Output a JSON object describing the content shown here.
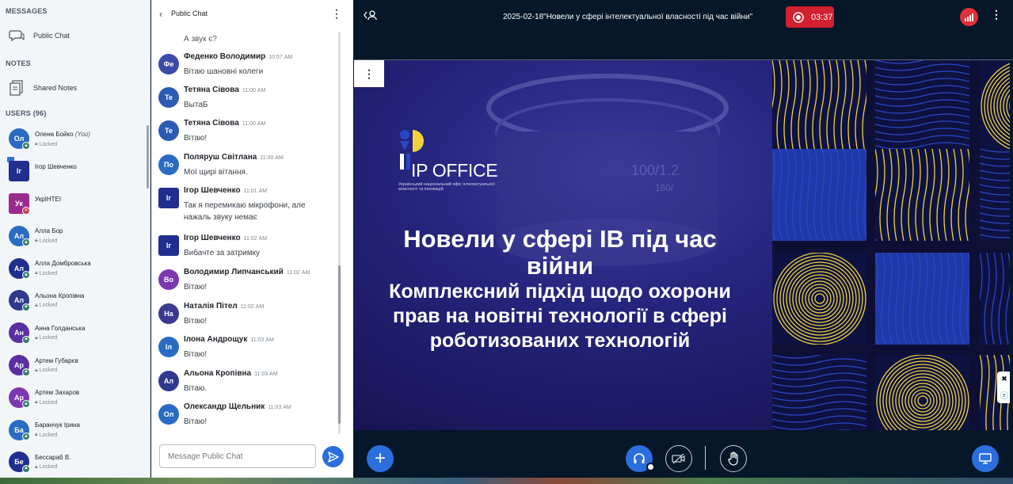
{
  "sidebar": {
    "messages_title": "MESSAGES",
    "public_chat_label": "Public Chat",
    "notes_title": "NOTES",
    "shared_notes_label": "Shared Notes",
    "users_title": "USERS (96)",
    "locked_label": "Locked",
    "users": [
      {
        "initials": "Ол",
        "name": "Олена Бойко",
        "you": "(You)",
        "color": "#2a6cc4",
        "shape": "circle",
        "status": "locked",
        "presenter": false
      },
      {
        "initials": "Іг",
        "name": "Ігор Шевченко",
        "you": "",
        "color": "#1f2e8f",
        "shape": "square",
        "status": "none",
        "presenter": true
      },
      {
        "initials": "Ук",
        "name": "УкрІНТЕІ",
        "you": "",
        "color": "#9b2a8f",
        "shape": "square",
        "status": "muted",
        "presenter": false
      },
      {
        "initials": "Ал",
        "name": "Алла Бор",
        "you": "",
        "color": "#2a6cc4",
        "shape": "circle",
        "status": "locked",
        "presenter": false
      },
      {
        "initials": "Ал",
        "name": "Алла Домбровська",
        "you": "",
        "color": "#1f2e8f",
        "shape": "circle",
        "status": "locked",
        "presenter": false
      },
      {
        "initials": "Ал",
        "name": "Альона Кропівна",
        "you": "",
        "color": "#2f3a8f",
        "shape": "circle",
        "status": "locked",
        "presenter": false
      },
      {
        "initials": "Ан",
        "name": "Анна Голданська",
        "you": "",
        "color": "#5a2fa3",
        "shape": "circle",
        "status": "locked",
        "presenter": false
      },
      {
        "initials": "Ар",
        "name": "Артем Губарєв",
        "you": "",
        "color": "#5a2fa3",
        "shape": "circle",
        "status": "locked",
        "presenter": false
      },
      {
        "initials": "Ар",
        "name": "Артем Захаров",
        "you": "",
        "color": "#7c38b0",
        "shape": "circle",
        "status": "locked",
        "presenter": false
      },
      {
        "initials": "Ба",
        "name": "Баранчук Ірина",
        "you": "",
        "color": "#2a6cc4",
        "shape": "circle",
        "status": "locked",
        "presenter": false
      },
      {
        "initials": "Бе",
        "name": "Бессараб В.",
        "you": "",
        "color": "#1f2e8f",
        "shape": "circle",
        "status": "locked",
        "presenter": false
      }
    ]
  },
  "chat": {
    "title": "Public Chat",
    "faded_message": "А звук є?",
    "messages": [
      {
        "initials": "Фе",
        "name": "Феденко Володимир",
        "time": "10:57 AM",
        "text": "Вітаю шановні колеги",
        "color": "#3a4aa8",
        "shape": "circle"
      },
      {
        "initials": "Те",
        "name": "Тетяна Сівова",
        "time": "11:00 AM",
        "text": "ВытаБ",
        "color": "#2a5cb4",
        "shape": "circle"
      },
      {
        "initials": "Те",
        "name": "Тетяна Сівова",
        "time": "11:00 AM",
        "text": "Вітаю!",
        "color": "#2a5cb4",
        "shape": "circle"
      },
      {
        "initials": "По",
        "name": "Поляруш Світлана",
        "time": "11:00 AM",
        "text": "Мої щирі вітання.",
        "color": "#2a6cc4",
        "shape": "circle"
      },
      {
        "initials": "Іг",
        "name": "Ігор Шевченко",
        "time": "11:01 AM",
        "text": "Так я перемикаю мікрофони, але нажаль звуку немає",
        "color": "#1f2e8f",
        "shape": "square"
      },
      {
        "initials": "Іг",
        "name": "Ігор Шевченко",
        "time": "11:02 AM",
        "text": "Вибачте за затримку",
        "color": "#1f2e8f",
        "shape": "square"
      },
      {
        "initials": "Во",
        "name": "Володимир Липчанський",
        "time": "11:02 AM",
        "text": "Вітаю!",
        "color": "#7c38b0",
        "shape": "circle"
      },
      {
        "initials": "На",
        "name": "Наталія Пітел",
        "time": "11:02 AM",
        "text": "Вітаю!",
        "color": "#3a3a8f",
        "shape": "circle"
      },
      {
        "initials": "Іл",
        "name": "Ілона Андрощук",
        "time": "11:03 AM",
        "text": "Вітаю!",
        "color": "#2a6cc4",
        "shape": "circle"
      },
      {
        "initials": "Ал",
        "name": "Альона Кропівна",
        "time": "11:03 AM",
        "text": "Вітаю.",
        "color": "#2f3a8f",
        "shape": "circle"
      },
      {
        "initials": "Ол",
        "name": "Олександр Щельник",
        "time": "11:03 AM",
        "text": "Вітаю!",
        "color": "#2a6cc4",
        "shape": "circle"
      }
    ],
    "input_placeholder": "Message Public Chat"
  },
  "main": {
    "meeting_title": "2025-02-18\"Новели у сфері інтелектуальної власності під час війни\"",
    "recording_time": "03:37",
    "slide": {
      "logo_text": "IP OFFICE",
      "logo_subtitle": "Український національний офіс інтелектуальної власності та інновацій",
      "title": "Новели у сфері ІВ під час війни",
      "subtitle": "Комплексний підхід щодо охорони прав на новітні технології в сфері роботизованих технологій"
    }
  },
  "colors": {
    "accent": "#2b6fde",
    "recording": "#d2202e",
    "main_bg": "#06172a",
    "slide_yellow": "#f2d23a",
    "slide_blue": "#2a46c8"
  }
}
